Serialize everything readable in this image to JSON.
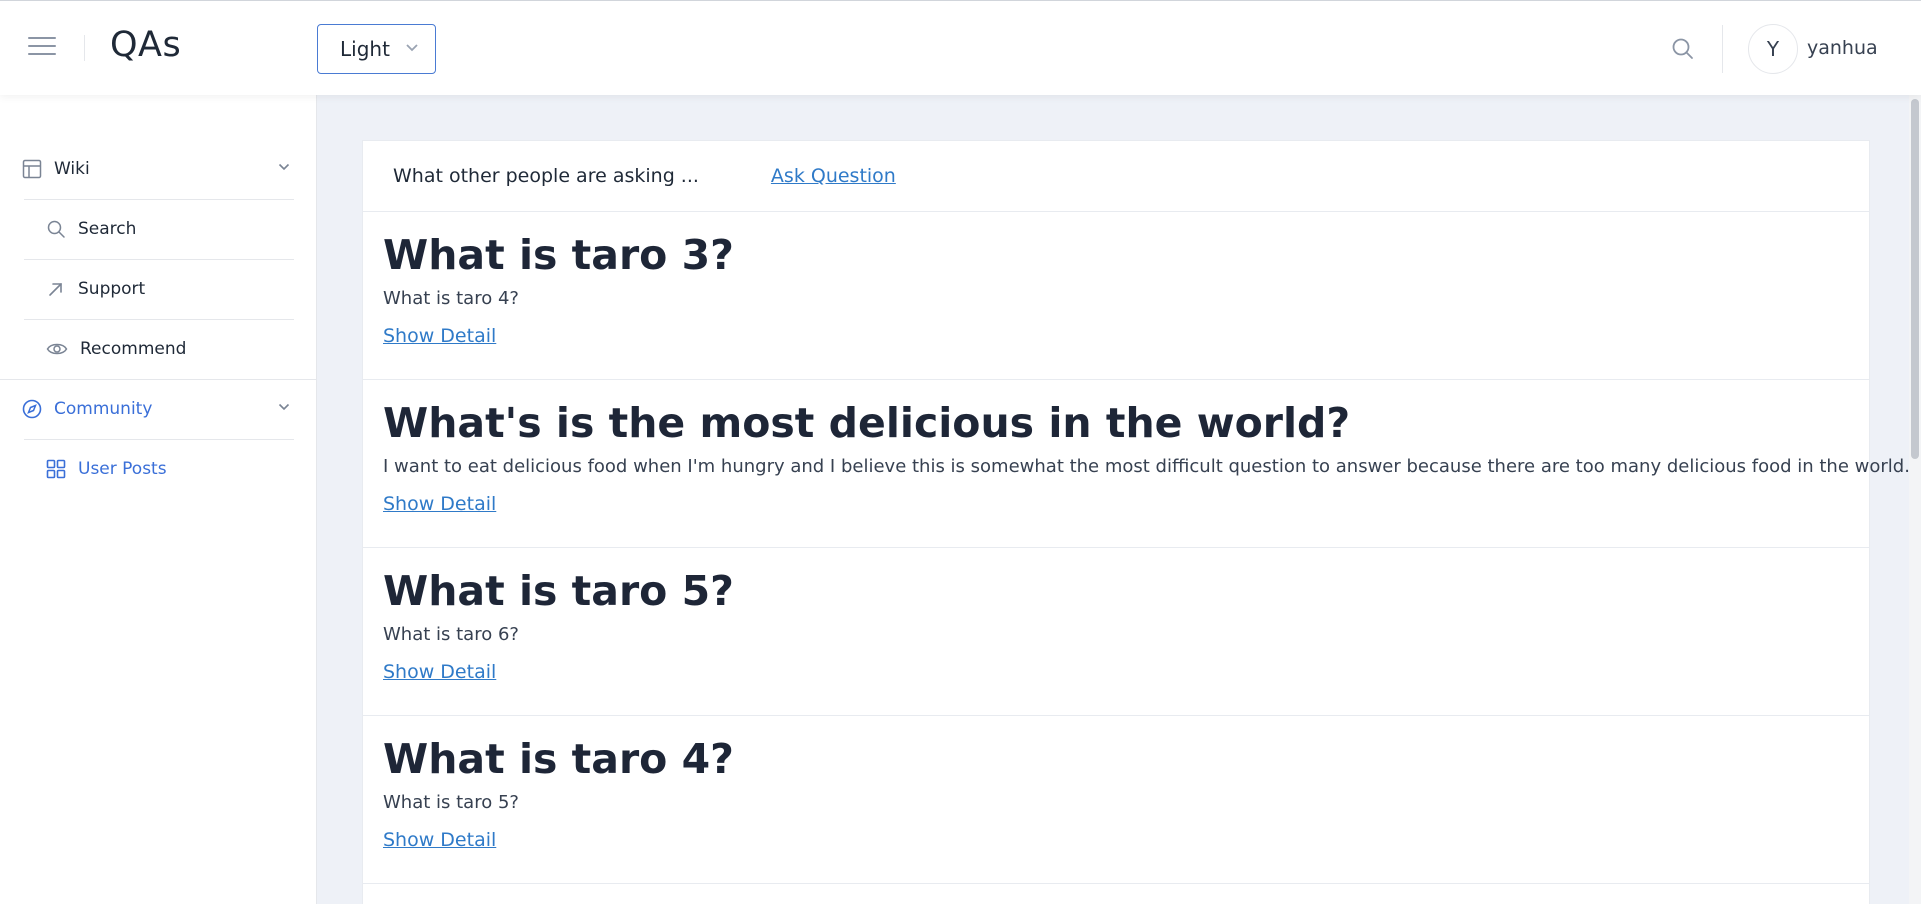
{
  "header": {
    "title": "QAs",
    "theme_value": "Light",
    "user_initial": "Y",
    "username": "yanhua"
  },
  "sidebar": {
    "groups": [
      {
        "label": "Wiki",
        "icon": "layout-icon",
        "items": [
          {
            "label": "Search",
            "icon": "search-icon"
          },
          {
            "label": "Support",
            "icon": "arrow-up-right-icon"
          },
          {
            "label": "Recommend",
            "icon": "eye-icon"
          }
        ]
      },
      {
        "label": "Community",
        "icon": "compass-icon",
        "active": true,
        "items": [
          {
            "label": "User Posts",
            "icon": "grid-icon",
            "active": true
          }
        ]
      }
    ]
  },
  "main": {
    "asking_label": "What other people are asking ...",
    "ask_link": "Ask Question",
    "questions": [
      {
        "title": "What is taro 3?",
        "body": "What is taro 4?",
        "link": "Show Detail"
      },
      {
        "title": "What's is the most delicious in the world?",
        "body": "I want to eat delicious food when I'm hungry and I believe this is somewhat the most difficult question to answer because there are too many delicious food in the world.",
        "link": "Show Detail"
      },
      {
        "title": "What is taro 5?",
        "body": "What is taro 6?",
        "link": "Show Detail"
      },
      {
        "title": "What is taro 4?",
        "body": "What is taro 5?",
        "link": "Show Detail"
      }
    ]
  },
  "colors": {
    "accent": "#3a6fd8",
    "link": "#2f7ac8",
    "page_bg": "#eef1f7"
  }
}
